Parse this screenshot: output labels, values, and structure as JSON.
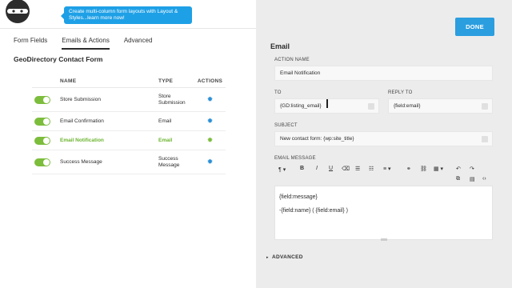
{
  "promo": {
    "text": "Create multi-column form layouts with Layout & Styles...learn more now!"
  },
  "tabs": [
    {
      "label": "Form Fields"
    },
    {
      "label": "Emails & Actions"
    },
    {
      "label": "Advanced"
    }
  ],
  "form_title": "GeoDirectory Contact Form",
  "table": {
    "headers": {
      "name": "NAME",
      "type": "TYPE",
      "actions": "ACTIONS"
    },
    "rows": [
      {
        "name": "Store Submission",
        "type": "Store Submission"
      },
      {
        "name": "Email Confirmation",
        "type": "Email"
      },
      {
        "name": "Email Notification",
        "type": "Email"
      },
      {
        "name": "Success Message",
        "type": "Success Message"
      }
    ]
  },
  "done_label": "DONE",
  "panel": {
    "title": "Email",
    "action_name_label": "ACTION NAME",
    "action_name_value": "Email Notification",
    "to_label": "TO",
    "to_value": "{GD:listing_email}",
    "reply_to_label": "REPLY TO",
    "reply_to_value": "{field:email}",
    "subject_label": "SUBJECT",
    "subject_value": "New contact form: {wp:site_title}",
    "message_label": "EMAIL MESSAGE",
    "message_lines": [
      "{field:message}",
      "-{field:name} ( {field:email} )"
    ],
    "advanced_label": "ADVANCED"
  },
  "toolbar": {
    "paragraph": "¶",
    "bold": "B",
    "italic": "I",
    "underline": "U"
  }
}
